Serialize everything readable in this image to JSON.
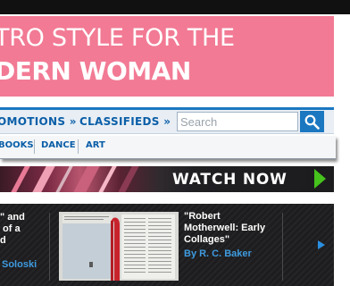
{
  "banner": {
    "line1": "TRO STYLE FOR THE",
    "line2": "DERN WOMAN",
    "color": "#f27a94"
  },
  "nav": {
    "items": [
      {
        "label": "OMOTIONS",
        "arrow": "»"
      },
      {
        "label": "CLASSIFIEDS",
        "arrow": "»"
      }
    ],
    "search_placeholder": "Search",
    "search_icon": "magnifier-icon",
    "accent": "#1b78c0"
  },
  "subnav": {
    "items": [
      "BOOKS",
      "DANCE",
      "ART"
    ]
  },
  "video_banner": {
    "label": "WATCH NOW",
    "arrow_color": "#46c21c"
  },
  "feature": {
    "left_text": "\" and\n of a\nd",
    "left_byline": "Soloski",
    "title": "\"Robert\nMotherwell: Early\nCollages\"",
    "byline": "By R. C. Baker",
    "link_color": "#3f9be0"
  }
}
